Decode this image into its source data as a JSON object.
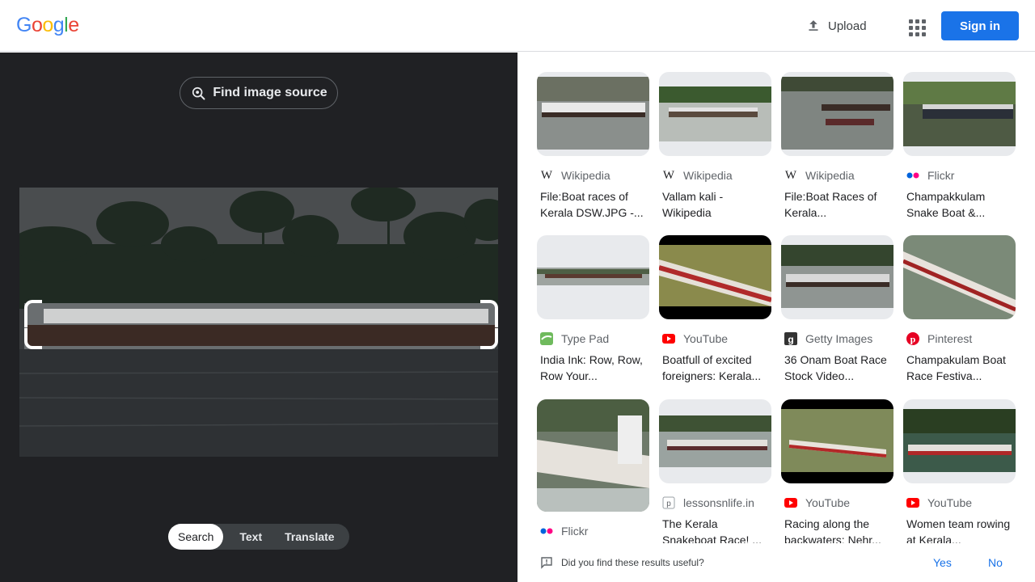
{
  "header": {
    "logo": [
      "G",
      "o",
      "o",
      "g",
      "l",
      "e"
    ],
    "upload_label": "Upload",
    "signin_label": "Sign in"
  },
  "lens": {
    "find_source_label": "Find image source",
    "modes": [
      "Search",
      "Text",
      "Translate"
    ],
    "active_mode": "Search"
  },
  "results": [
    {
      "source": "Wikipedia",
      "icon": "wikipedia-icon",
      "title": "File:Boat races of Kerala DSW.JPG -..."
    },
    {
      "source": "Wikipedia",
      "icon": "wikipedia-icon",
      "title": "Vallam kali - Wikipedia"
    },
    {
      "source": "Wikipedia",
      "icon": "wikipedia-icon",
      "title": "File:Boat Races of Kerala..."
    },
    {
      "source": "Flickr",
      "icon": "flickr-icon",
      "title": "Champakkulam Snake Boat &..."
    },
    {
      "source": "Type Pad",
      "icon": "typepad-icon",
      "title": "India Ink: Row, Row, Row Your..."
    },
    {
      "source": "YouTube",
      "icon": "youtube-icon",
      "title": "Boatfull of excited foreigners: Kerala..."
    },
    {
      "source": "Getty Images",
      "icon": "getty-icon",
      "title": "36 Onam Boat Race Stock Video..."
    },
    {
      "source": "Pinterest",
      "icon": "pinterest-icon",
      "title": "Champakulam Boat Race Festiva..."
    },
    {
      "source": "Flickr",
      "icon": "flickr-icon",
      "title": ""
    },
    {
      "source": "lessonsnlife.in",
      "icon": "lessonsnlife-icon",
      "title": "The Kerala Snakeboat Race! ..."
    },
    {
      "source": "YouTube",
      "icon": "youtube-icon",
      "title": "Racing along the backwaters: Nehr..."
    },
    {
      "source": "YouTube",
      "icon": "youtube-icon",
      "title": "Women team rowing at Kerala..."
    }
  ],
  "feedback": {
    "question": "Did you find these results useful?",
    "yes": "Yes",
    "no": "No"
  },
  "colors": {
    "accent": "#1a73e8",
    "dark_panel": "#202124"
  }
}
